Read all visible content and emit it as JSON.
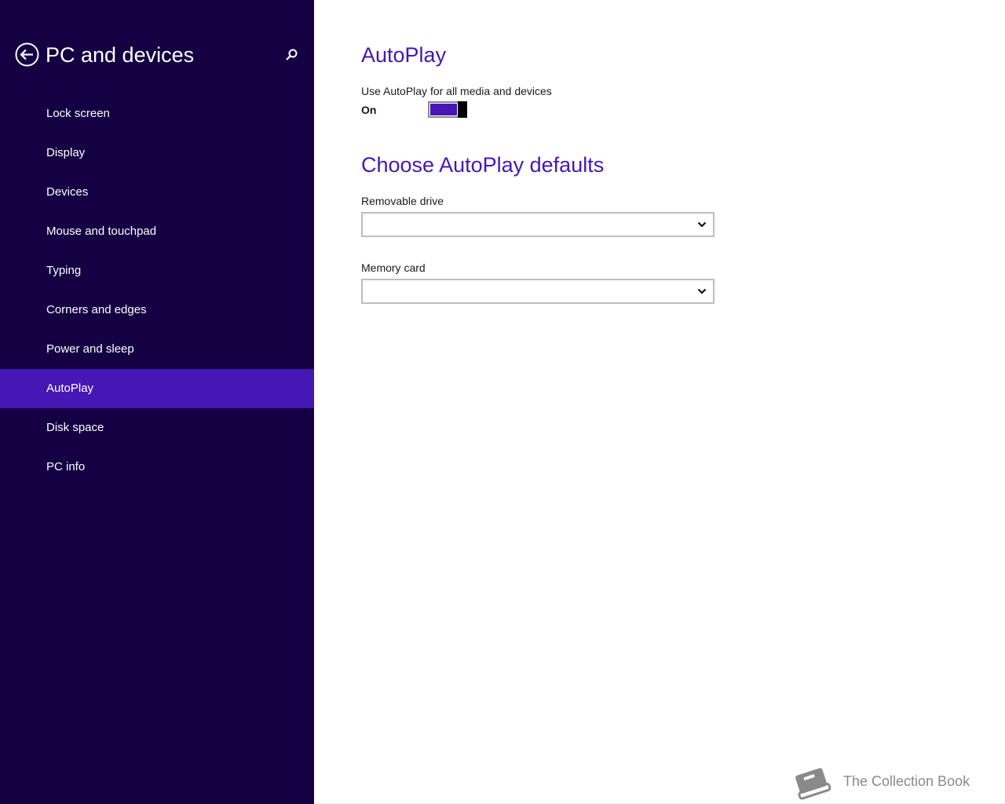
{
  "sidebar": {
    "title": "PC and devices",
    "back_icon": "back-arrow-circle-icon",
    "search_icon": "search-icon",
    "items": [
      {
        "label": "Lock screen"
      },
      {
        "label": "Display"
      },
      {
        "label": "Devices"
      },
      {
        "label": "Mouse and touchpad"
      },
      {
        "label": "Typing"
      },
      {
        "label": "Corners and edges"
      },
      {
        "label": "Power and sleep"
      },
      {
        "label": "AutoPlay"
      },
      {
        "label": "Disk space"
      },
      {
        "label": "PC info"
      }
    ],
    "selected_item": "AutoPlay"
  },
  "main": {
    "autoplay": {
      "title": "AutoPlay",
      "toggle_label": "Use AutoPlay for all media and devices",
      "toggle_state": "On"
    },
    "defaults": {
      "title": "Choose AutoPlay defaults",
      "removable_drive": {
        "label": "Removable drive",
        "value": ""
      },
      "memory_card": {
        "label": "Memory card",
        "value": ""
      }
    }
  },
  "watermark": {
    "text": "The Collection Book",
    "icon": "book-icon"
  },
  "colors": {
    "sidebar_bg": "#140042",
    "accent": "#4617b4",
    "selected_bg": "#4617b4",
    "text_dark": "#1a1a1a",
    "watermark": "#8a8a8a"
  }
}
